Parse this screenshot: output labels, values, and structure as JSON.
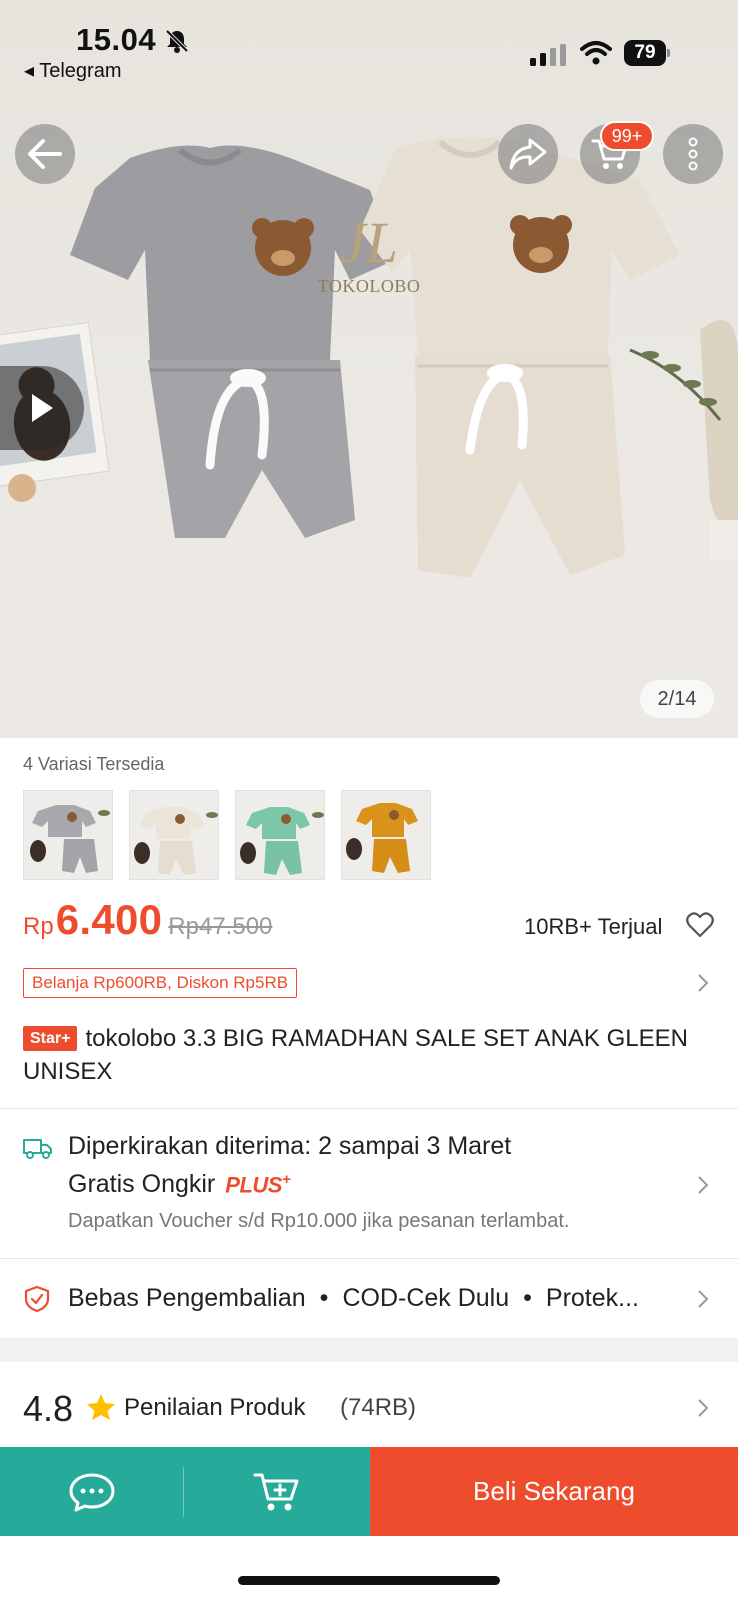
{
  "status_bar": {
    "time": "15.04",
    "back_app": "◂ Telegram",
    "battery": "79"
  },
  "header": {
    "cart_badge": "99+"
  },
  "gallery": {
    "counter": "2/14",
    "watermark_name": "TOKOLOBO"
  },
  "variants": {
    "title": "4 Variasi Tersedia",
    "items": [
      {
        "name": "gray",
        "color": "#a9a9ad"
      },
      {
        "name": "cream",
        "color": "#e8e2d6"
      },
      {
        "name": "mint",
        "color": "#7cc7a8"
      },
      {
        "name": "mustard",
        "color": "#d9921a"
      }
    ]
  },
  "price": {
    "currency": "Rp",
    "value": "6.400",
    "original": "Rp47.500",
    "sold": "10RB+ Terjual",
    "promo": "Belanja Rp600RB, Diskon Rp5RB"
  },
  "product": {
    "badge": "Star+",
    "title": "tokolobo 3.3 BIG RAMADHAN SALE SET ANAK GLEEN UNISEX"
  },
  "shipping": {
    "estimate": "Diperkirakan diterima: 2 sampai 3 Maret",
    "free_shipping": "Gratis Ongkir",
    "plus_label": "PLUS",
    "plus_sup": "+",
    "voucher_note": "Dapatkan Voucher s/d Rp10.000 jika pesanan terlambat."
  },
  "guarantees": {
    "items": [
      "Bebas Pengembalian",
      "COD-Cek Dulu",
      "Protek..."
    ],
    "separator": "•"
  },
  "rating": {
    "score": "4.8",
    "label": "Penilaian Produk",
    "count": "(74RB)"
  },
  "bottom_bar": {
    "buy_label": "Beli Sekarang"
  },
  "colors": {
    "brand": "#ee4d2d",
    "teal": "#26aa99"
  }
}
